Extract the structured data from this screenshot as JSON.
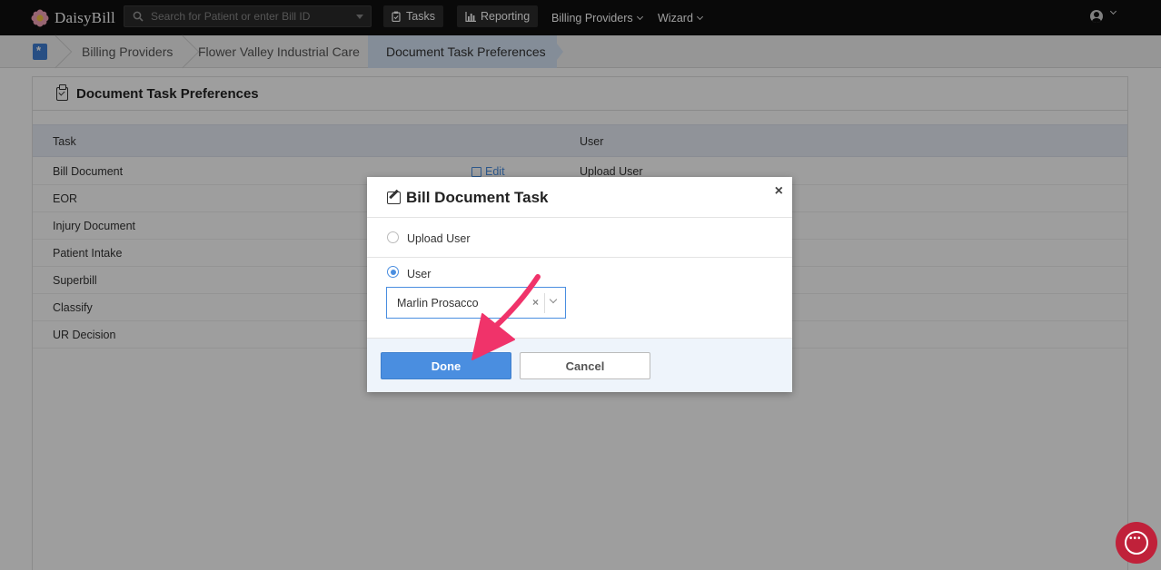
{
  "app": {
    "name": "DaisyBill"
  },
  "topnav": {
    "search_placeholder": "Search for Patient or enter Bill ID",
    "tasks_label": "Tasks",
    "reporting_label": "Reporting",
    "billing_providers_label": "Billing Providers",
    "wizard_label": "Wizard"
  },
  "breadcrumb": {
    "items": [
      "Billing Providers",
      "Flower Valley Industrial Care",
      "Document Task Preferences"
    ]
  },
  "page": {
    "title": "Document Task Preferences",
    "columns": {
      "task": "Task",
      "user": "User"
    },
    "rows": [
      {
        "task": "Bill Document",
        "action": "Edit",
        "user": "Upload User"
      },
      {
        "task": "EOR"
      },
      {
        "task": "Injury Document"
      },
      {
        "task": "Patient Intake"
      },
      {
        "task": "Superbill"
      },
      {
        "task": "Classify"
      },
      {
        "task": "UR Decision"
      }
    ]
  },
  "modal": {
    "title": "Bill Document Task",
    "close_label": "×",
    "option_upload_user": "Upload User",
    "option_user": "User",
    "selected_option": "User",
    "user_select_value": "Marlin Prosacco",
    "select_clear": "×",
    "done_label": "Done",
    "cancel_label": "Cancel"
  },
  "colors": {
    "accent": "#4a8ee0",
    "annotation_arrow": "#f0336a",
    "chat_button": "#c0213a"
  },
  "icons": [
    "daisy-logo-icon",
    "search-icon",
    "tasks-icon",
    "reporting-icon",
    "user-account-icon",
    "home-icon",
    "clipboard-icon",
    "edit-icon",
    "pencil-square-icon",
    "close-icon",
    "chevron-down-icon",
    "chat-icon"
  ]
}
